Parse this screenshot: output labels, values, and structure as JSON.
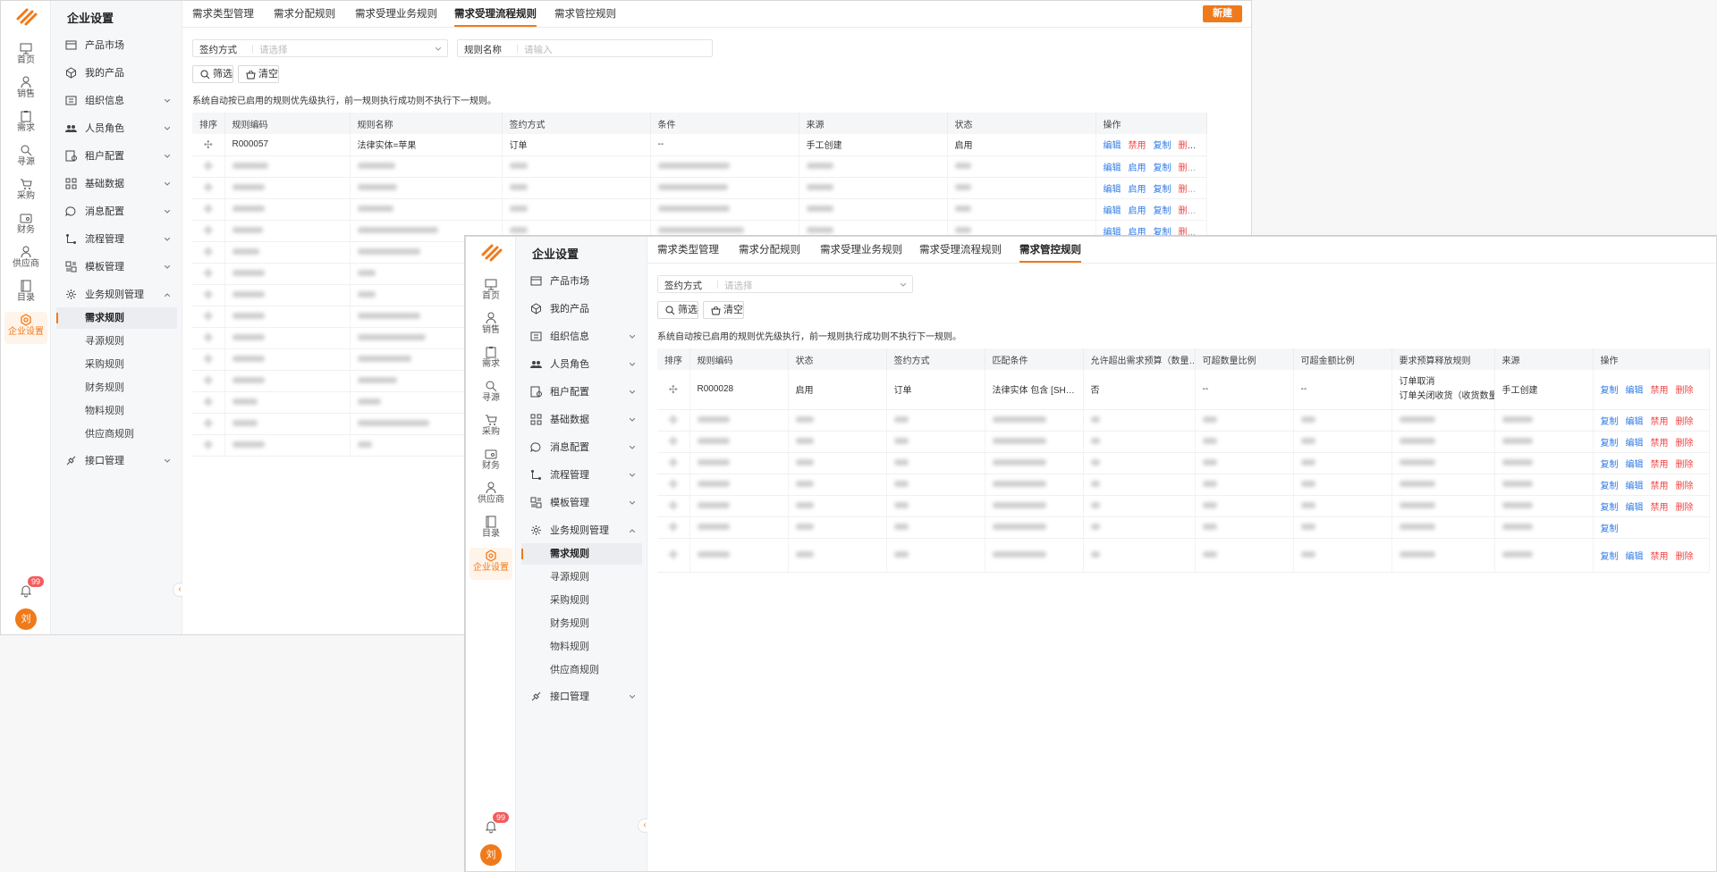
{
  "common": {
    "nav": [
      {
        "key": "home",
        "label": "首页",
        "icon": "monitor-icon"
      },
      {
        "key": "sales",
        "label": "销售",
        "icon": "person-icon"
      },
      {
        "key": "demand",
        "label": "需求",
        "icon": "clipboard-icon"
      },
      {
        "key": "source",
        "label": "寻源",
        "icon": "search-icon"
      },
      {
        "key": "purchase",
        "label": "采购",
        "icon": "cart-icon"
      },
      {
        "key": "finance",
        "label": "财务",
        "icon": "wallet-icon"
      },
      {
        "key": "supplier",
        "label": "供应商",
        "icon": "person-icon"
      },
      {
        "key": "catalog",
        "label": "目录",
        "icon": "book-icon"
      },
      {
        "key": "enterprise",
        "label": "企业设置",
        "icon": "hexagon-gear-icon",
        "active": true
      }
    ],
    "badge_count": "99",
    "avatar_initial": "刘",
    "menu_title": "企业设置",
    "menu": [
      {
        "label": "产品市场",
        "icon": "browser-icon",
        "expandable": false
      },
      {
        "label": "我的产品",
        "icon": "cube-icon",
        "expandable": false
      },
      {
        "label": "组织信息",
        "icon": "org-icon",
        "expandable": true
      },
      {
        "label": "人员角色",
        "icon": "users-icon",
        "expandable": true
      },
      {
        "label": "租户配置",
        "icon": "tenant-icon",
        "expandable": true
      },
      {
        "label": "基础数据",
        "icon": "grid-icon",
        "expandable": true
      },
      {
        "label": "消息配置",
        "icon": "message-icon",
        "expandable": true
      },
      {
        "label": "流程管理",
        "icon": "flow-icon",
        "expandable": true
      },
      {
        "label": "模板管理",
        "icon": "template-icon",
        "expandable": true
      },
      {
        "label": "业务规则管理",
        "icon": "gear-icon",
        "expandable": true,
        "expanded": true
      }
    ],
    "submenu": [
      "需求规则",
      "寻源规则",
      "采购规则",
      "财务规则",
      "物料规则",
      "供应商规则"
    ],
    "submenu_active": "需求规则",
    "menu_last": {
      "label": "接口管理",
      "icon": "plug-icon"
    },
    "tabs": [
      "需求类型管理",
      "需求分配规则",
      "需求受理业务规则",
      "需求受理流程规则",
      "需求管控规则"
    ],
    "filter_button": "筛选",
    "clear_button": "清空",
    "hint": "系统自动按已启用的规则优先级执行，前一规则执行成功则不执行下一规则。",
    "field_sign_label": "签约方式",
    "field_sign_placeholder": "请选择"
  },
  "window1": {
    "active_tab": "需求受理流程规则",
    "new_button": "新建",
    "field_rule_label": "规则名称",
    "field_rule_placeholder": "请输入",
    "columns": [
      "排序",
      "规则编码",
      "规则名称",
      "签约方式",
      "条件",
      "来源",
      "状态",
      "操作"
    ],
    "row": {
      "code": "R000057",
      "name": "法律实体=苹果",
      "sign": "订单",
      "condition": "--",
      "source": "手工创建",
      "status": "启用"
    },
    "row_ops": [
      "编辑",
      "禁用",
      "复制",
      "删除"
    ],
    "blurred_ops": [
      "编辑",
      "启用",
      "复制",
      "删除"
    ]
  },
  "window2": {
    "active_tab": "需求管控规则",
    "columns": [
      "排序",
      "规则编码",
      "状态",
      "签约方式",
      "匹配条件",
      "允许超出需求预算（数量…",
      "可超数量比例",
      "可超金额比例",
      "要求预算释放规则",
      "来源",
      "操作"
    ],
    "row": {
      "code": "R000028",
      "status": "启用",
      "sign": "订单",
      "condition": "法律实体 包含 [SHIQ…",
      "allow": "否",
      "qty_ratio": "--",
      "amt_ratio": "--",
      "release_1": "订单取消",
      "release_2": "订单关闭收货（收货数量/金",
      "source": "手工创建"
    },
    "row_ops": [
      "复制",
      "编辑",
      "禁用",
      "删除"
    ],
    "copy_only": "复制"
  }
}
